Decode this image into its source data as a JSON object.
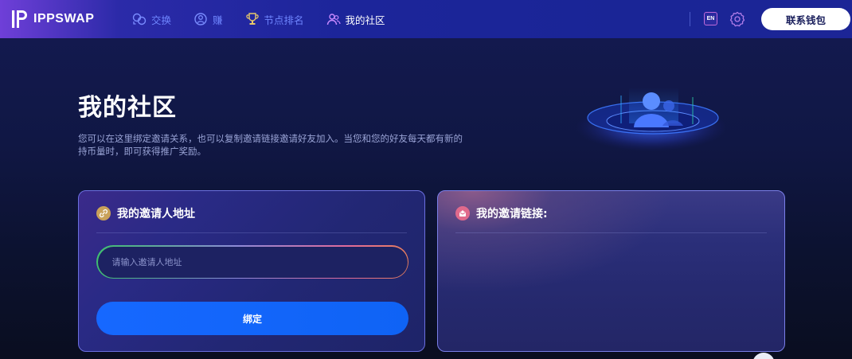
{
  "brand": {
    "name": "IPPSWAP"
  },
  "nav": {
    "items": [
      {
        "label": "交换",
        "icon": "exchange-icon",
        "active": false
      },
      {
        "label": "赚",
        "icon": "earn-icon",
        "active": false
      },
      {
        "label": "节点排名",
        "icon": "trophy-icon",
        "active": false
      },
      {
        "label": "我的社区",
        "icon": "community-icon",
        "active": true
      }
    ]
  },
  "toolbar": {
    "lang_label": "EN",
    "settings_icon": "gear-icon",
    "connect_label": "联系钱包"
  },
  "hero": {
    "title": "我的社区",
    "description": "您可以在这里绑定邀请关系，也可以复制邀请链接邀请好友加入。当您和您的好友每天都有新的持币量时，即可获得推广奖励。",
    "art_icon": "community-hologram-icon"
  },
  "inviter_card": {
    "title": "我的邀请人地址",
    "icon": "link-icon",
    "input_placeholder": "请输入邀请人地址",
    "input_value": "",
    "button_label": "绑定"
  },
  "invite_link_card": {
    "title": "我的邀请链接:",
    "icon": "envelope-icon"
  },
  "colors": {
    "header_start": "#6f3fd8",
    "header_main": "#1c259a",
    "nav_inactive": "#6f86ff",
    "primary_button": "#1668ff",
    "background": "#101744"
  }
}
